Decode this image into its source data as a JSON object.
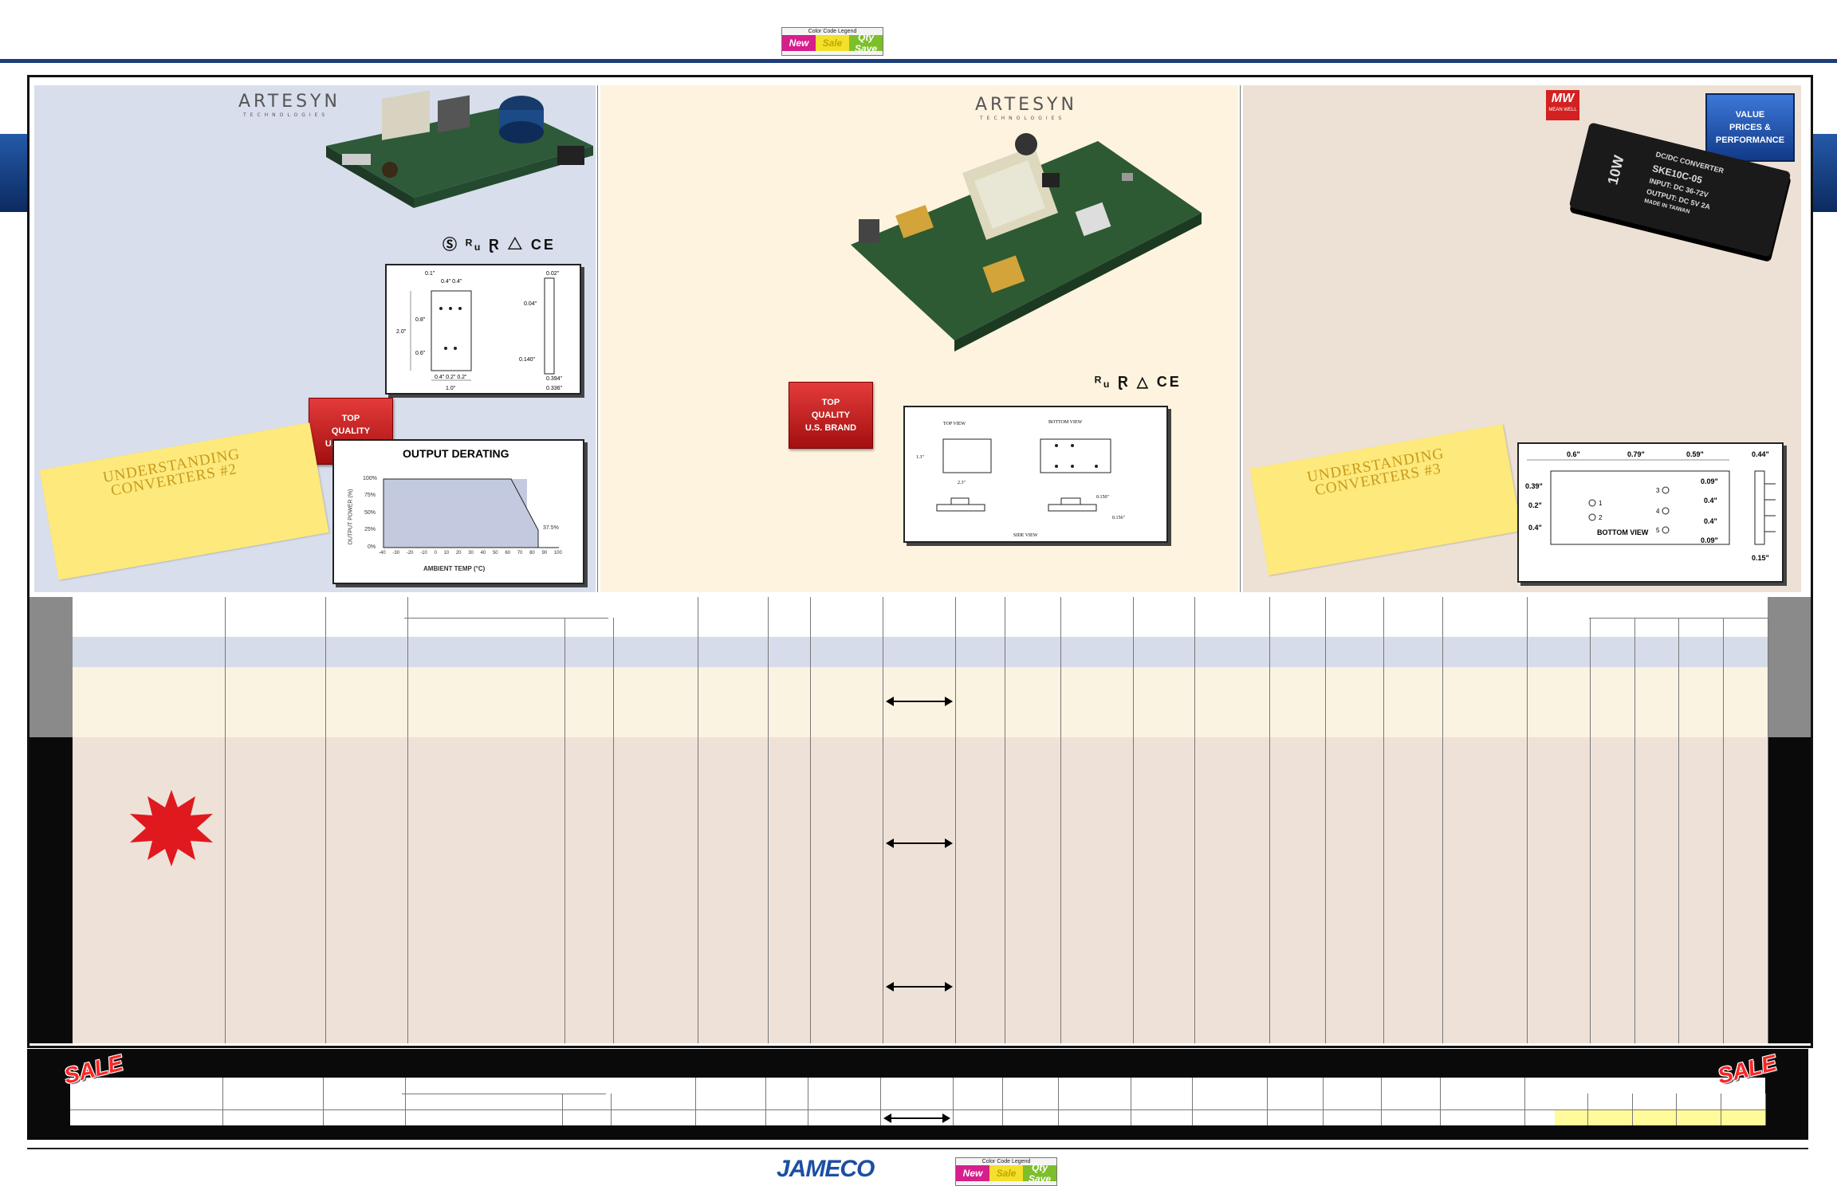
{
  "legend": {
    "title": "Color Code Legend",
    "items": [
      {
        "label": "New",
        "color": "#d61e8c"
      },
      {
        "label": "Sale",
        "color": "#f2e02a"
      },
      {
        "label": "Qty Save",
        "color": "#7cbf2a"
      }
    ]
  },
  "panels": {
    "left": {
      "brand": "ARTESYN",
      "brand_sub": "TECHNOLOGIES",
      "badge": [
        "TOP",
        "QUALITY",
        "U.S. BRAND"
      ],
      "note": [
        "UNDERSTANDING",
        "CONVERTERS #2"
      ],
      "derating": {
        "title": "OUTPUT DERATING",
        "ylabel": "OUTPUT POWER (%)",
        "xlabel": "AMBIENT TEMP (°C)",
        "yticks": [
          "100%",
          "75%",
          "50%",
          "25%",
          "0%"
        ],
        "xticks": [
          "-40",
          "-30",
          "-20",
          "-10",
          "0",
          "10",
          "20",
          "30",
          "40",
          "50",
          "60",
          "70",
          "80",
          "90",
          "100"
        ],
        "end_label": "37.5%"
      },
      "dims": [
        "0.1\"",
        "0.4\"",
        "0.4\"",
        "0.02\"",
        "2.0\"",
        "0.8\"",
        "0.04\"",
        "0.6\"",
        "0.140\"",
        "0.4\"",
        "0.2\"",
        "0.2\"",
        "1.0\"",
        "0.394\"",
        "0.336\""
      ]
    },
    "middle": {
      "brand": "ARTESYN",
      "brand_sub": "TECHNOLOGIES",
      "badge": [
        "TOP",
        "QUALITY",
        "U.S. BRAND"
      ],
      "dims": [
        "TOP VIEW",
        "BOTTOM VIEW",
        "SIDE VIEW",
        "1.3\"",
        "2.3\"",
        "0.156\"",
        "0.150\""
      ]
    },
    "right": {
      "brand": "MW",
      "brand_sub": "MEAN WELL",
      "value_badge": [
        "VALUE",
        "PRICES &",
        "PERFORMANCE"
      ],
      "note": [
        "UNDERSTANDING",
        "CONVERTERS #3"
      ],
      "product_label": [
        "DC/DC CONVERTER",
        "SKE10C-05",
        "INPUT: DC 36-72V",
        "OUTPUT: DC 5V 2A",
        "MADE IN TAIWAN"
      ],
      "product_watts": "10W",
      "dims": [
        "0.6\"",
        "0.79\"",
        "0.59\"",
        "0.44\"",
        "0.39\"",
        "0.09\"",
        "0.2\"",
        "0.4\"",
        "0.4\"",
        "0.4\"",
        "0.09\"",
        "0.15\"",
        "BOTTOM VIEW",
        "1",
        "2",
        "3",
        "4",
        "5"
      ]
    }
  },
  "footer": {
    "brand": "JAMECO",
    "sale": "SALE"
  },
  "colors": {
    "frame_blue": "#1d3c7a",
    "left_bg": "#d8deeb",
    "middle_bg": "#fdf3df",
    "right_bg": "#ede1d6",
    "row_blue": "#d6dcea",
    "row_cream": "#fbf3e1",
    "row_tan": "#eee2d8",
    "row_grey": "#8a8a8a",
    "sale_yellow": "#fffb9a"
  }
}
